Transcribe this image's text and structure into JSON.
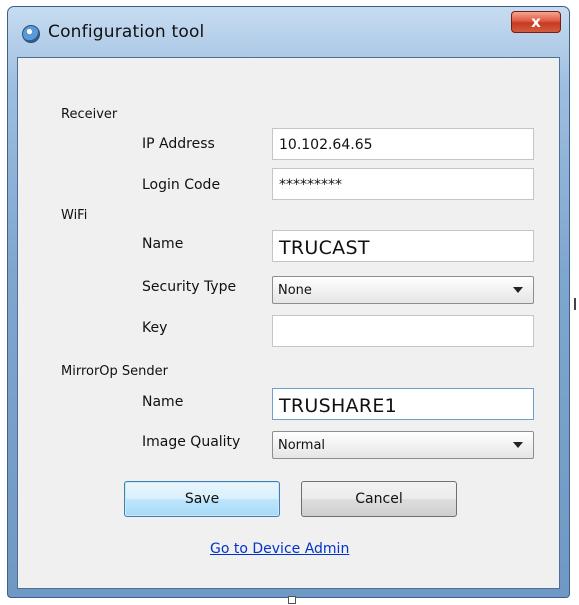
{
  "window": {
    "title": "Configuration tool",
    "close_label": "x"
  },
  "receiver": {
    "section_label": "Receiver",
    "ip_label": "IP Address",
    "ip_value": "10.102.64.65",
    "login_label": "Login Code",
    "login_value": "*********"
  },
  "wifi": {
    "section_label": "WiFi",
    "name_label": "Name",
    "name_value": "TRUCAST",
    "security_label": "Security Type",
    "security_value": "None",
    "key_label": "Key",
    "key_value": ""
  },
  "sender": {
    "section_label": "MirrorOp Sender",
    "name_label": "Name",
    "name_value": "TRUSHARE1",
    "quality_label": "Image Quality",
    "quality_value": "Normal"
  },
  "buttons": {
    "save": "Save",
    "cancel": "Cancel"
  },
  "link": {
    "device_admin": "Go to Device Admin"
  },
  "colors": {
    "frame": "#7fa6cf",
    "client_bg": "#f0f0f0",
    "close_red": "#c43b22",
    "link_blue": "#0033cc",
    "save_border": "#3c7fb1"
  },
  "icons": {
    "app": "app-icon",
    "close": "close-icon",
    "dropdown": "chevron-down-icon"
  }
}
